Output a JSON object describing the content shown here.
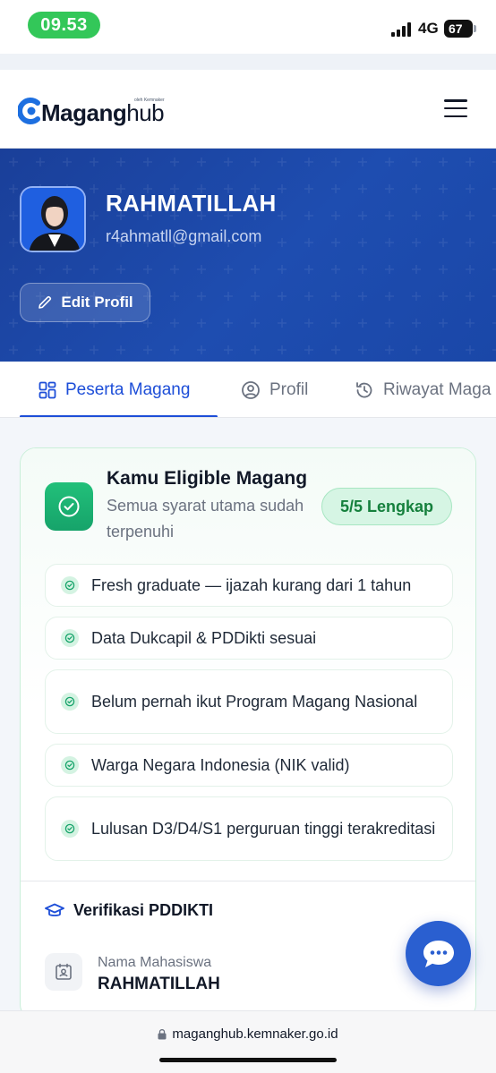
{
  "status_bar": {
    "time": "09.53",
    "network": "4G",
    "battery": "67"
  },
  "header": {
    "logo_main": "Maganghub",
    "logo_main_a": "Magang",
    "logo_main_b": "hub",
    "logo_sub": "oleh Kemnaker"
  },
  "profile": {
    "name": "RAHMATILLAH",
    "email": "r4ahmatll@gmail.com",
    "edit_label": "Edit Profil"
  },
  "tabs": [
    {
      "label": "Peserta Magang",
      "icon": "dashboard-grid-icon",
      "active": true
    },
    {
      "label": "Profil",
      "icon": "user-circle-icon",
      "active": false
    },
    {
      "label": "Riwayat Maga",
      "icon": "history-icon",
      "active": false
    }
  ],
  "eligibility": {
    "title": "Kamu Eligible Magang",
    "subtitle": "Semua syarat utama sudah terpenuhi",
    "badge": "5/5 Lengkap",
    "requirements": [
      "Fresh graduate — ijazah kurang dari 1 tahun",
      "Data Dukcapil & PDDikti sesuai",
      "Belum pernah ikut Program Magang Nasional",
      "Warga Negara Indonesia (NIK valid)",
      "Lulusan D3/D4/S1 perguruan tinggi terakreditasi"
    ]
  },
  "verification": {
    "title": "Verifikasi PDDIKTI",
    "fields": [
      {
        "label": "Nama Mahasiswa",
        "value": "RAHMATILLAH"
      }
    ]
  },
  "browser": {
    "url": "maganghub.kemnaker.go.id"
  },
  "colors": {
    "primary": "#1d4ed8",
    "hero": "#1e4db0",
    "success": "#16a36a",
    "success_badge_bg": "#d6f5e4"
  }
}
